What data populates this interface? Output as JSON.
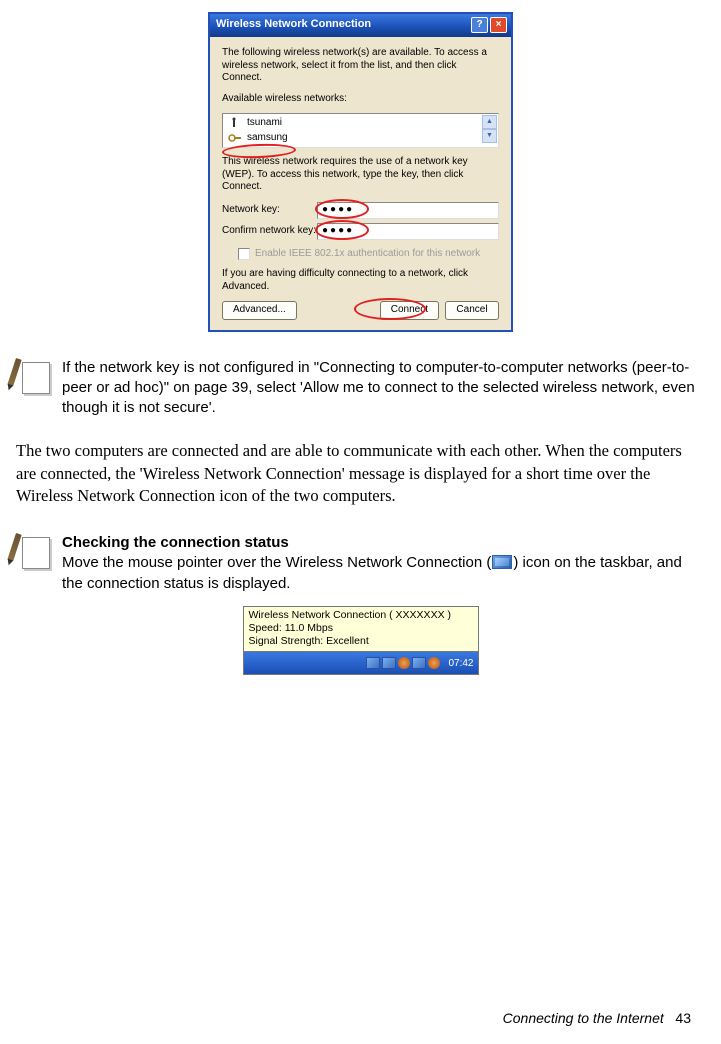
{
  "dialog": {
    "title": "Wireless Network Connection",
    "intro": "The following wireless network(s) are available. To access a wireless network, select it from the list, and then click Connect.",
    "available_label": "Available wireless networks:",
    "networks": [
      "tsunami",
      "samsung"
    ],
    "wep_text": "This wireless network requires the use of a network key (WEP). To access this network, type the key, then click Connect.",
    "key_label": "Network key:",
    "confirm_label": "Confirm network key:",
    "key_value": "●●●●",
    "confirm_value": "●●●●",
    "ieee_check": "Enable IEEE 802.1x authentication for this network",
    "difficulty_text": "If you are having difficulty connecting to a network, click Advanced.",
    "buttons": {
      "advanced": "Advanced...",
      "connect": "Connect",
      "cancel": "Cancel"
    }
  },
  "note1": "If the network key is not configured in \"Connecting to computer-to-computer networks (peer-to-peer or ad hoc)\" on page 39, select 'Allow me to connect to the selected wireless network, even though it is not secure'.",
  "paragraph": "The two computers are connected and are able to communicate with each other. When the computers are connected, the 'Wireless Network Connection' message is displayed for a short time over the Wireless Network Connection icon of the two computers.",
  "note2": {
    "title": "Checking the connection status",
    "text_before": "Move the mouse pointer over the Wireless Network Connection (",
    "text_after": ") icon on the taskbar, and the connection status is displayed."
  },
  "tooltip": {
    "line1": "Wireless Network Connection (   XXXXXXX   )",
    "line2": "Speed: 11.0 Mbps",
    "line3": "Signal Strength: Excellent",
    "clock": "07:42"
  },
  "footer": {
    "section": "Connecting to the Internet",
    "page": "43"
  }
}
